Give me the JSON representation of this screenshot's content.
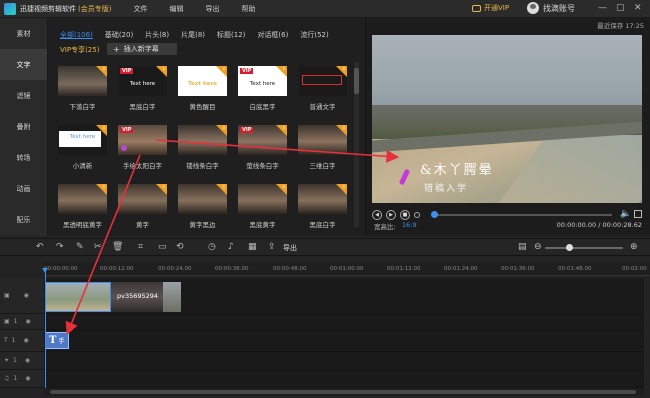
{
  "app": {
    "title": "迅捷视频剪辑软件",
    "edition": "(会员专版)",
    "menu": [
      "文件",
      "编辑",
      "导出",
      "帮助"
    ],
    "vip_label": "开通VIP",
    "account_label": "找滴账号",
    "window_controls": {
      "minimize": "—",
      "maximize": "▢",
      "close": "✕"
    }
  },
  "sidebar": {
    "items": [
      {
        "label": "素材",
        "active": false
      },
      {
        "label": "文字",
        "active": true
      },
      {
        "label": "滤镜",
        "active": false
      },
      {
        "label": "叠附",
        "active": false
      },
      {
        "label": "转场",
        "active": false
      },
      {
        "label": "动画",
        "active": false
      },
      {
        "label": "配乐",
        "active": false
      }
    ]
  },
  "library": {
    "categories": [
      {
        "label": "全部(106)",
        "active": true
      },
      {
        "label": "基础(20)",
        "active": false
      },
      {
        "label": "片头(8)",
        "active": false
      },
      {
        "label": "片尾(8)",
        "active": false
      },
      {
        "label": "标题(12)",
        "active": false
      },
      {
        "label": "对话框(6)",
        "active": false
      },
      {
        "label": "流行(52)",
        "active": false
      }
    ],
    "vip_category": "VIP专享(25)",
    "add_subtitle_label": "插入新字幕",
    "tiles": [
      {
        "label": "下落白字",
        "sample": "",
        "vip": false
      },
      {
        "label": "黑底白字",
        "sample": "Text here",
        "vip": true
      },
      {
        "label": "黄色醒目",
        "sample": "Text here",
        "vip": false
      },
      {
        "label": "白底黑字",
        "sample": "Text here",
        "vip": true
      },
      {
        "label": "普通文字",
        "sample": "",
        "vip": false
      },
      {
        "label": "小清新",
        "sample": "Text here",
        "vip": false
      },
      {
        "label": "手绘太阳白字",
        "sample": "",
        "vip": true
      },
      {
        "label": "镂线条白字",
        "sample": "",
        "vip": false
      },
      {
        "label": "萤线条白字",
        "sample": "",
        "vip": true
      },
      {
        "label": "三维白字",
        "sample": "",
        "vip": false
      },
      {
        "label": "黑透明底黄字",
        "sample": "",
        "vip": false
      },
      {
        "label": "黄字",
        "sample": "",
        "vip": false
      },
      {
        "label": "黄字黑边",
        "sample": "",
        "vip": false
      },
      {
        "label": "黑底黄字",
        "sample": "",
        "vip": false
      },
      {
        "label": "黑底白字",
        "sample": "",
        "vip": false
      }
    ]
  },
  "preview": {
    "autosave": "最近保存 17:25",
    "caption_line1": "&木丫腭晕",
    "caption_line2": "错稿入学",
    "ratio_label": "宽高比:",
    "ratio_value": "16:9",
    "time": "00:00:00.00 / 00:00:28.62",
    "progress": 0.0
  },
  "timeline": {
    "export_label": "导出",
    "ruler_ticks": [
      "00:00:00.00",
      "00:00:12.00",
      "00:00:24.00",
      "00:00:36.00",
      "00:00:48.00",
      "00:01:00.00",
      "00:01:12.00",
      "00:01:24.00",
      "00:01:36.00",
      "00:01:48.00",
      "00:02:00"
    ],
    "tracks": [
      {
        "label": "",
        "type": "video"
      },
      {
        "label": "1",
        "type": "overlay"
      },
      {
        "label": "1",
        "type": "text"
      },
      {
        "label": "1",
        "type": "effect"
      },
      {
        "label": "1",
        "type": "music"
      }
    ],
    "clip2_label": "pv35695294",
    "text_clip_label": "手"
  },
  "colors": {
    "accent": "#3c8ef0",
    "vip": "#e8b84a",
    "vip_badge": "#d81e2c",
    "arrow": "#e8303a"
  }
}
